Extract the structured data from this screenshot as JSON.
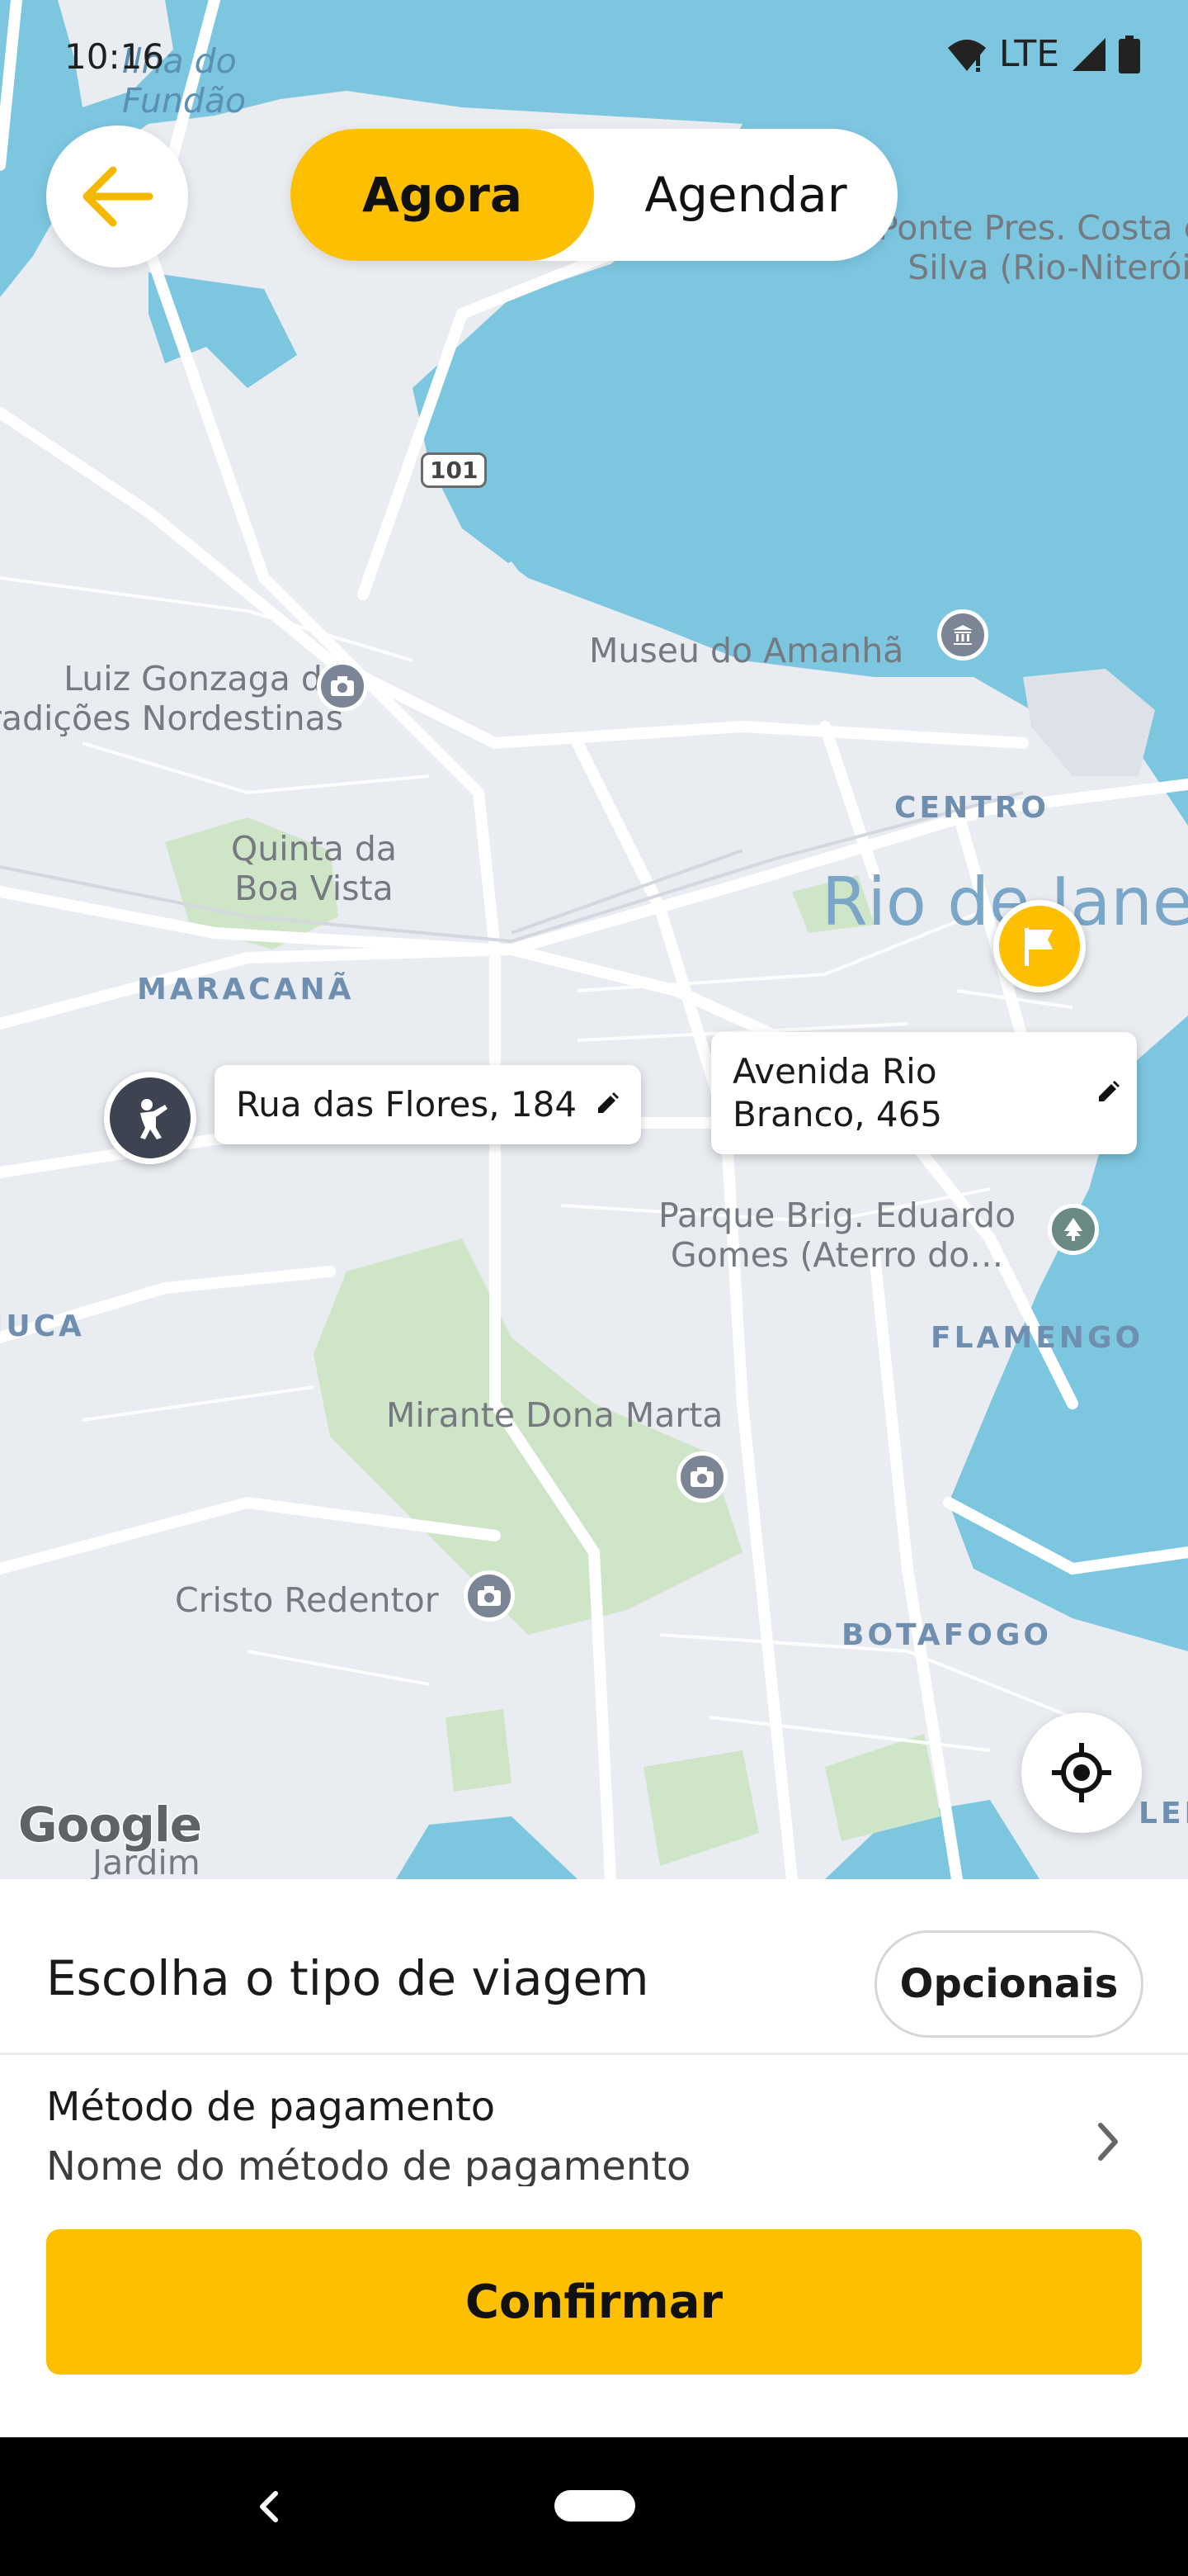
{
  "status_bar": {
    "time": "10:16",
    "network": "LTE",
    "icons": [
      "wifi-icon",
      "signal-icon",
      "battery-icon"
    ]
  },
  "top": {
    "back_icon": "arrow-left-icon",
    "segments": [
      {
        "label": "Agora",
        "active": true
      },
      {
        "label": "Agendar",
        "active": false
      }
    ]
  },
  "map": {
    "labels": {
      "fundao": "Ilha do\nFundão",
      "ponte": "Ponte Pres. Costa e\nSilva (Rio-Niterói)",
      "museu": "Museu do Amanhã",
      "luiz": "Luiz Gonzaga de\nTradições Nordestinas",
      "centro": "CENTRO",
      "quinta": "Quinta da\nBoa Vista",
      "rio": "Rio de Janeiro",
      "maracana": "MARACANÃ",
      "parque": "Parque Brig. Eduardo\nGomes (Aterro do…",
      "tijuca": "TIJUCA",
      "flamengo": "FLAMENGO",
      "mirante": "Mirante Dona Marta",
      "cristo": "Cristo Redentor",
      "botafogo": "BOTAFOGO",
      "leme": "LEME",
      "jardim": "Jardim",
      "route_shield": "101"
    },
    "attribution": "Google",
    "origin": {
      "address": "Rua das Flores, 184",
      "icon": "person-waving-icon"
    },
    "destination": {
      "address": "Avenida Rio Branco, 465",
      "icon": "flag-icon"
    },
    "locate_icon": "gps-target-icon"
  },
  "sheet": {
    "trip_type_title": "Escolha o tipo de viagem",
    "options_button": "Opcionais",
    "payment_title": "Método de pagamento",
    "payment_value": "Nome do método de pagamento",
    "confirm_button": "Confirmar"
  },
  "colors": {
    "accent": "#fcc000",
    "water": "#7dc6e0",
    "land": "#e9ecf1",
    "park": "#cfe5c8"
  }
}
